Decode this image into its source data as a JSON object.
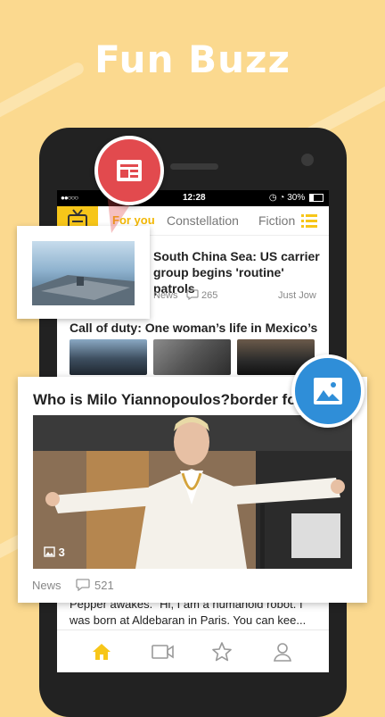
{
  "headline": "Fun Buzz",
  "status_bar": {
    "time": "12:28",
    "battery": "30%"
  },
  "tabs": [
    {
      "label": "For you",
      "active": true
    },
    {
      "label": "Constellation",
      "active": false
    },
    {
      "label": "Fiction",
      "active": false
    }
  ],
  "feed": {
    "item1": {
      "title": "South China Sea: US carrier group begins 'routine' patrols",
      "category": "News",
      "comments": "265",
      "time": "Just Jow"
    },
    "item2": {
      "title": "Call of duty: One woman’s life in Mexico’s"
    },
    "item3": {
      "text": "Pepper awakes. “Hi, I am a humanoid robot. I was born at Aldebaran in Paris. You can kee..."
    }
  },
  "featured": {
    "title": "Who is Milo Yiannopoulos?border for",
    "image_count": "3",
    "category": "News",
    "comments": "521"
  },
  "bottom_nav": [
    {
      "icon": "home-icon",
      "active": true
    },
    {
      "icon": "video-icon",
      "active": false
    },
    {
      "icon": "star-icon",
      "active": false
    },
    {
      "icon": "profile-icon",
      "active": false
    }
  ],
  "colors": {
    "background": "#fbd98f",
    "accent_yellow": "#f7c619",
    "badge_red": "#e24a4e",
    "badge_blue": "#2f8ed8"
  }
}
